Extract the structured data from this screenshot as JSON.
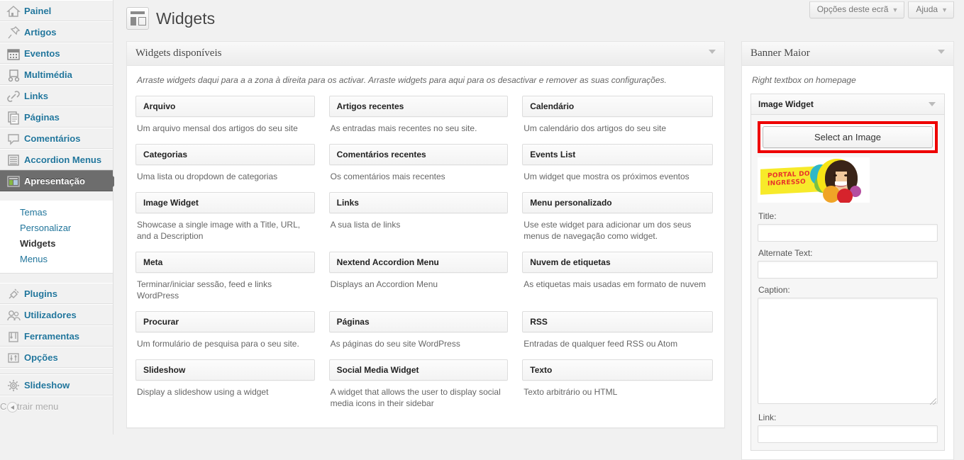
{
  "screen_meta": {
    "options_label": "Opções deste ecrã",
    "help_label": "Ajuda",
    "caret": "▼"
  },
  "page": {
    "title": "Widgets"
  },
  "admin_menu": {
    "items": [
      {
        "label": "Painel",
        "icon": "dashboard-icon"
      },
      {
        "label": "Artigos",
        "icon": "pin-icon"
      },
      {
        "label": "Eventos",
        "icon": "calendar-icon"
      },
      {
        "label": "Multimédia",
        "icon": "media-icon"
      },
      {
        "label": "Links",
        "icon": "link-icon"
      },
      {
        "label": "Páginas",
        "icon": "pages-icon"
      },
      {
        "label": "Comentários",
        "icon": "comment-bubble-icon"
      },
      {
        "label": "Accordion Menus",
        "icon": "list-icon"
      },
      {
        "label": "Apresentação",
        "icon": "appearance-icon",
        "current": true
      }
    ],
    "submenu": [
      {
        "label": "Temas"
      },
      {
        "label": "Personalizar"
      },
      {
        "label": "Widgets",
        "current": true
      },
      {
        "label": "Menus"
      }
    ],
    "items_lower": [
      {
        "label": "Plugins",
        "icon": "plug-icon"
      },
      {
        "label": "Utilizadores",
        "icon": "users-icon"
      },
      {
        "label": "Ferramentas",
        "icon": "tools-icon"
      },
      {
        "label": "Opções",
        "icon": "settings-icon"
      }
    ],
    "items_last": [
      {
        "label": "Slideshow",
        "icon": "gear-icon"
      }
    ],
    "collapse_label": "Contrair menu"
  },
  "available_panel": {
    "heading": "Widgets disponíveis",
    "intro": "Arraste widgets daqui para a a zona à direita para os activar. Arraste widgets para aqui para os desactivar e remover as suas configurações.",
    "widgets": [
      {
        "name": "Arquivo",
        "desc": "Um arquivo mensal dos artigos do seu site"
      },
      {
        "name": "Artigos recentes",
        "desc": "As entradas mais recentes no seu site."
      },
      {
        "name": "Calendário",
        "desc": "Um calendário dos artigos do seu site"
      },
      {
        "name": "Categorias",
        "desc": "Uma lista ou dropdown de categorias"
      },
      {
        "name": "Comentários recentes",
        "desc": "Os comentários mais recentes"
      },
      {
        "name": "Events List",
        "desc": "Um widget que mostra os próximos eventos"
      },
      {
        "name": "Image Widget",
        "desc": "Showcase a single image with a Title, URL, and a Description"
      },
      {
        "name": "Links",
        "desc": "A sua lista de links"
      },
      {
        "name": "Menu personalizado",
        "desc": "Use este widget para adicionar um dos seus menus de navegação como widget."
      },
      {
        "name": "Meta",
        "desc": "Terminar/iniciar sessão, feed e links WordPress"
      },
      {
        "name": "Nextend Accordion Menu",
        "desc": "Displays an Accordion Menu"
      },
      {
        "name": "Nuvem de etiquetas",
        "desc": "As etiquetas mais usadas em formato de nuvem"
      },
      {
        "name": "Procurar",
        "desc": "Um formulário de pesquisa para o seu site."
      },
      {
        "name": "Páginas",
        "desc": "As páginas do seu site WordPress"
      },
      {
        "name": "RSS",
        "desc": "Entradas de qualquer feed RSS ou Atom"
      },
      {
        "name": "Slideshow",
        "desc": "Display a slideshow using a widget"
      },
      {
        "name": "Social Media Widget",
        "desc": "A widget that allows the user to display social media icons in their sidebar"
      },
      {
        "name": "Texto",
        "desc": "Texto arbitrário ou HTML"
      }
    ]
  },
  "sidebar_panel": {
    "heading": "Banner Maior",
    "description": "Right textbox on homepage",
    "widget": {
      "title": "Image Widget",
      "select_image_button": "Select an Image",
      "highlight_color": "#ee0000",
      "image_alt": "Portal do Ingresso banner",
      "banner_text_line1": "PORTAL DO",
      "banner_text_line2": "INGRESSO",
      "fields": [
        {
          "label": "Title:",
          "value": "",
          "type": "text"
        },
        {
          "label": "Alternate Text:",
          "value": "",
          "type": "text"
        },
        {
          "label": "Caption:",
          "value": "",
          "type": "textarea"
        },
        {
          "label": "Link:",
          "value": "",
          "type": "text"
        }
      ]
    }
  }
}
